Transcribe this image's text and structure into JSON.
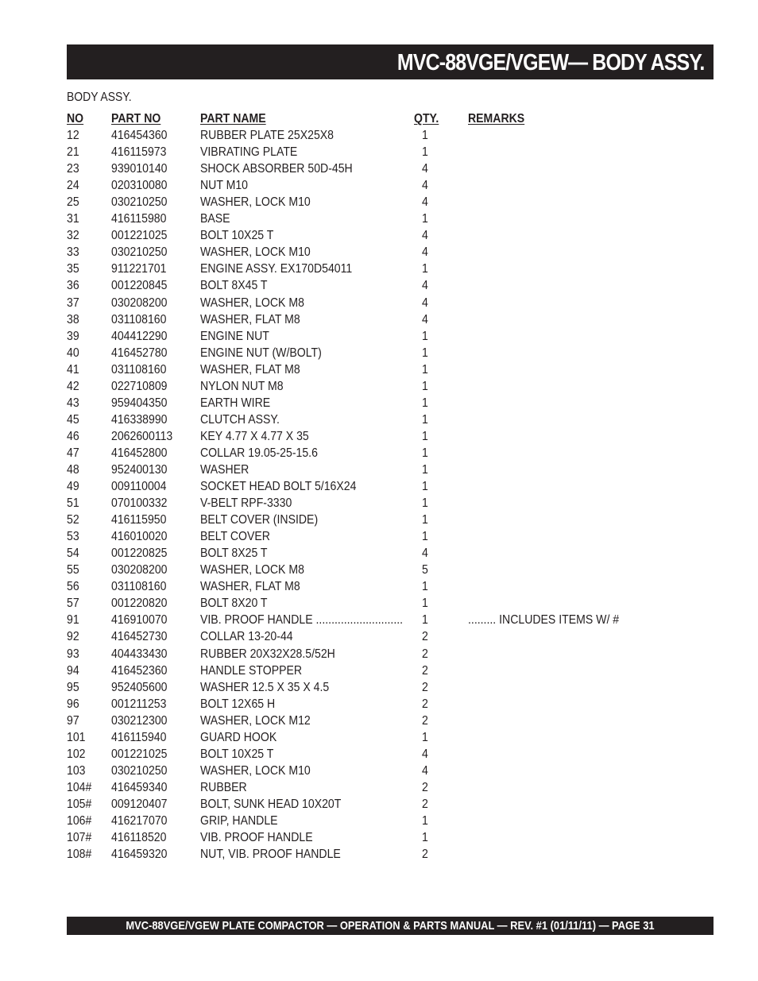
{
  "header": {
    "title": "MVC-88VGE/VGEW— BODY ASSY."
  },
  "section_label": "BODY  ASSY.",
  "table": {
    "columns": [
      "NO",
      "PART NO",
      "PART NAME",
      "QTY.",
      "REMARKS"
    ],
    "rows": [
      {
        "no": "12",
        "part_no": "416454360",
        "name": "RUBBER PLATE 25X25X8",
        "qty": "1",
        "remarks": ""
      },
      {
        "no": "21",
        "part_no": "416115973",
        "name": "VIBRATING PLATE",
        "qty": "1",
        "remarks": ""
      },
      {
        "no": "23",
        "part_no": "939010140",
        "name": "SHOCK ABSORBER 50D-45H",
        "qty": "4",
        "remarks": ""
      },
      {
        "no": "24",
        "part_no": "020310080",
        "name": "NUT M10",
        "qty": "4",
        "remarks": ""
      },
      {
        "no": "25",
        "part_no": "030210250",
        "name": "WASHER, LOCK M10",
        "qty": "4",
        "remarks": ""
      },
      {
        "no": "31",
        "part_no": "416115980",
        "name": "BASE",
        "qty": "1",
        "remarks": ""
      },
      {
        "no": "32",
        "part_no": "001221025",
        "name": "BOLT 10X25 T",
        "qty": "4",
        "remarks": ""
      },
      {
        "no": "33",
        "part_no": "030210250",
        "name": "WASHER, LOCK M10",
        "qty": "4",
        "remarks": ""
      },
      {
        "no": "35",
        "part_no": "911221701",
        "name": "ENGINE ASSY. EX170D54011",
        "qty": "1",
        "remarks": ""
      },
      {
        "no": "36",
        "part_no": "001220845",
        "name": "BOLT 8X45 T",
        "qty": "4",
        "remarks": ""
      },
      {
        "no": "37",
        "part_no": "030208200",
        "name": "WASHER, LOCK M8",
        "qty": "4",
        "remarks": ""
      },
      {
        "no": "38",
        "part_no": "031108160",
        "name": "WASHER, FLAT M8",
        "qty": "4",
        "remarks": ""
      },
      {
        "no": "39",
        "part_no": "404412290",
        "name": "ENGINE NUT",
        "qty": "1",
        "remarks": ""
      },
      {
        "no": "40",
        "part_no": "416452780",
        "name": "ENGINE NUT (W/BOLT)",
        "qty": "1",
        "remarks": ""
      },
      {
        "no": "41",
        "part_no": "031108160",
        "name": "WASHER, FLAT M8",
        "qty": "1",
        "remarks": ""
      },
      {
        "no": "42",
        "part_no": "022710809",
        "name": "NYLON NUT M8",
        "qty": "1",
        "remarks": ""
      },
      {
        "no": "43",
        "part_no": "959404350",
        "name": "EARTH WIRE",
        "qty": "1",
        "remarks": ""
      },
      {
        "no": "45",
        "part_no": "416338990",
        "name": "CLUTCH ASSY.",
        "qty": "1",
        "remarks": ""
      },
      {
        "no": "46",
        "part_no": "2062600113",
        "name": "KEY 4.77 X 4.77 X 35",
        "qty": "1",
        "remarks": ""
      },
      {
        "no": "47",
        "part_no": "416452800",
        "name": "COLLAR 19.05-25-15.6",
        "qty": "1",
        "remarks": ""
      },
      {
        "no": "48",
        "part_no": "952400130",
        "name": "WASHER",
        "qty": "1",
        "remarks": ""
      },
      {
        "no": "49",
        "part_no": "009110004",
        "name": "SOCKET HEAD BOLT 5/16X24",
        "qty": "1",
        "remarks": ""
      },
      {
        "no": "51",
        "part_no": "070100332",
        "name": "V-BELT RPF-3330",
        "qty": "1",
        "remarks": ""
      },
      {
        "no": "52",
        "part_no": "416115950",
        "name": "BELT COVER (INSIDE)",
        "qty": "1",
        "remarks": ""
      },
      {
        "no": "53",
        "part_no": "416010020",
        "name": "BELT COVER",
        "qty": "1",
        "remarks": ""
      },
      {
        "no": "54",
        "part_no": "001220825",
        "name": "BOLT 8X25 T",
        "qty": "4",
        "remarks": ""
      },
      {
        "no": "55",
        "part_no": "030208200",
        "name": "WASHER, LOCK M8",
        "qty": "5",
        "remarks": ""
      },
      {
        "no": "56",
        "part_no": "031108160",
        "name": "WASHER, FLAT M8",
        "qty": "1",
        "remarks": ""
      },
      {
        "no": "57",
        "part_no": "001220820",
        "name": "BOLT 8X20 T",
        "qty": "1",
        "remarks": ""
      },
      {
        "no": "91",
        "part_no": "416910070",
        "name": "VIB. PROOF HANDLE ............................",
        "qty": "1",
        "remarks": "......... INCLUDES ITEMS W/ #"
      },
      {
        "no": "92",
        "part_no": "416452730",
        "name": "COLLAR 13-20-44",
        "qty": "2",
        "remarks": ""
      },
      {
        "no": "93",
        "part_no": "404433430",
        "name": "RUBBER 20X32X28.5/52H",
        "qty": "2",
        "remarks": ""
      },
      {
        "no": "94",
        "part_no": "416452360",
        "name": "HANDLE STOPPER",
        "qty": "2",
        "remarks": ""
      },
      {
        "no": "95",
        "part_no": "952405600",
        "name": "WASHER 12.5 X 35 X 4.5",
        "qty": "2",
        "remarks": ""
      },
      {
        "no": "96",
        "part_no": "001211253",
        "name": "BOLT 12X65 H",
        "qty": "2",
        "remarks": ""
      },
      {
        "no": "97",
        "part_no": "030212300",
        "name": "WASHER, LOCK M12",
        "qty": "2",
        "remarks": ""
      },
      {
        "no": "101",
        "part_no": "416115940",
        "name": "GUARD HOOK",
        "qty": "1",
        "remarks": ""
      },
      {
        "no": "102",
        "part_no": "001221025",
        "name": "BOLT 10X25 T",
        "qty": "4",
        "remarks": ""
      },
      {
        "no": "103",
        "part_no": "030210250",
        "name": "WASHER, LOCK M10",
        "qty": "4",
        "remarks": ""
      },
      {
        "no": "104#",
        "part_no": "416459340",
        "name": "RUBBER",
        "qty": "2",
        "remarks": ""
      },
      {
        "no": "105#",
        "part_no": "009120407",
        "name": "BOLT, SUNK HEAD 10X20T",
        "qty": "2",
        "remarks": ""
      },
      {
        "no": "106#",
        "part_no": "416217070",
        "name": "GRIP, HANDLE",
        "qty": "1",
        "remarks": ""
      },
      {
        "no": "107#",
        "part_no": "416118520",
        "name": "VIB. PROOF HANDLE",
        "qty": "1",
        "remarks": ""
      },
      {
        "no": "108#",
        "part_no": "416459320",
        "name": "NUT, VIB. PROOF HANDLE",
        "qty": "2",
        "remarks": ""
      }
    ]
  },
  "footer": {
    "text": "MVC-88VGE/VGEW PLATE COMPACTOR —  OPERATION & PARTS MANUAL — REV. #1 (01/11/11) — PAGE 31"
  },
  "colors": {
    "bar_background": "#231f20",
    "bar_text": "#ffffff",
    "body_text": "#231f20"
  }
}
